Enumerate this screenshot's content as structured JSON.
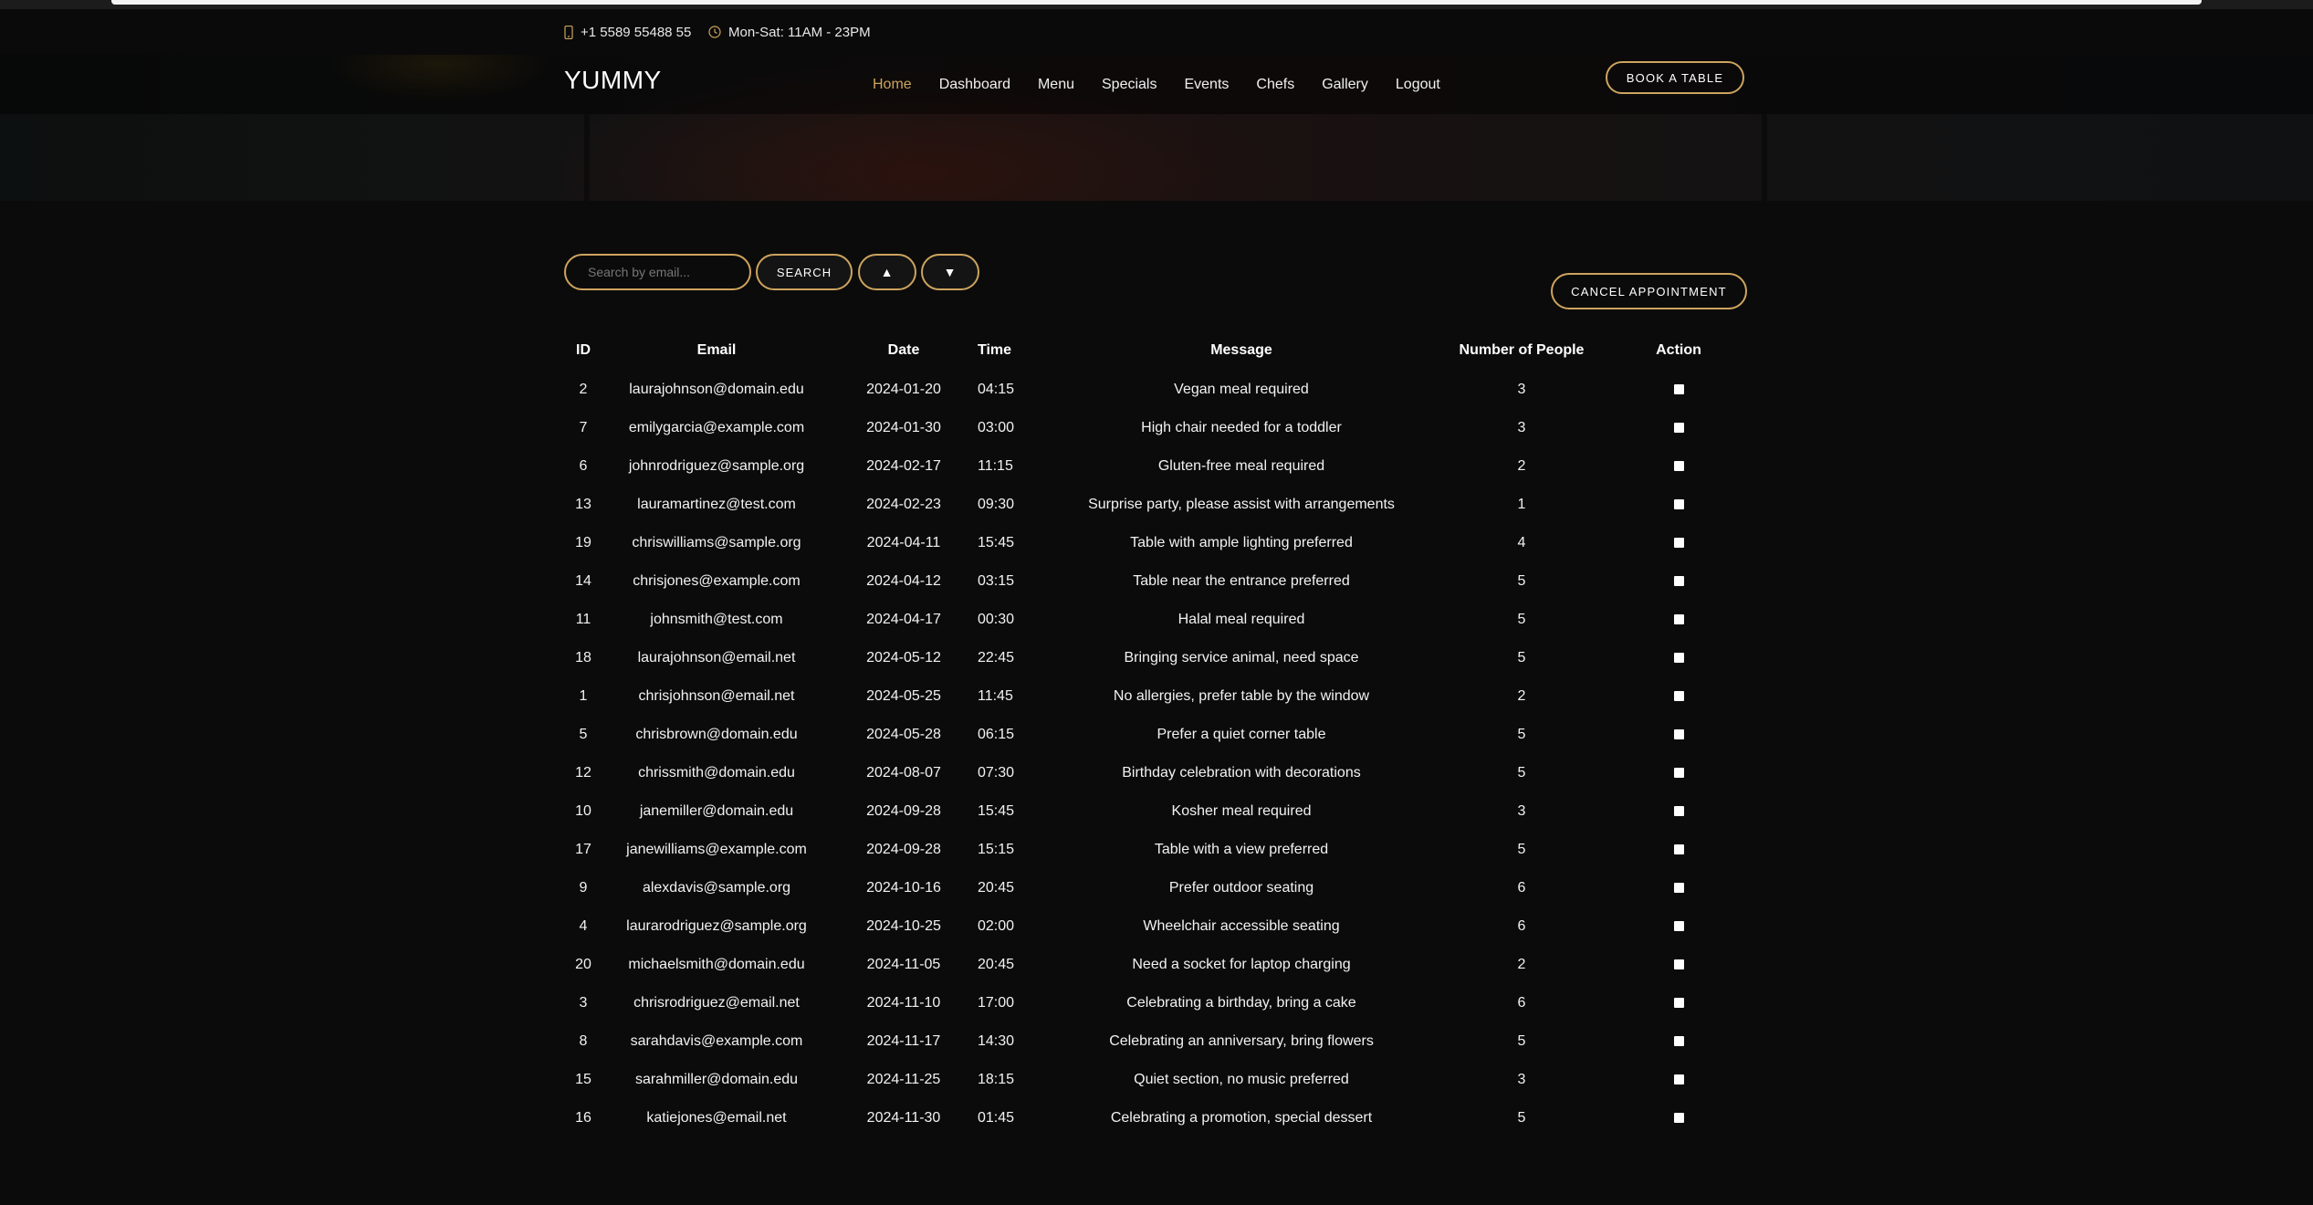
{
  "topbar": {
    "phone": "+1 5589 55488 55",
    "hours": "Mon-Sat: 11AM - 23PM"
  },
  "nav": {
    "logo": "YUMMY",
    "links": [
      "Home",
      "Dashboard",
      "Menu",
      "Specials",
      "Events",
      "Chefs",
      "Gallery",
      "Logout"
    ],
    "active": "Home",
    "cta": "BOOK A TABLE"
  },
  "controls": {
    "search_placeholder": "Search by email...",
    "search_label": "SEARCH",
    "sort_asc": "▲",
    "sort_desc": "▼",
    "cancel_label": "CANCEL APPOINTMENT"
  },
  "table": {
    "headers": [
      "ID",
      "Email",
      "Date",
      "Time",
      "Message",
      "Number of People",
      "Action"
    ],
    "rows": [
      {
        "id": "2",
        "email": "laurajohnson@domain.edu",
        "date": "2024-01-20",
        "time": "04:15",
        "message": "Vegan meal required",
        "people": "3"
      },
      {
        "id": "7",
        "email": "emilygarcia@example.com",
        "date": "2024-01-30",
        "time": "03:00",
        "message": "High chair needed for a toddler",
        "people": "3"
      },
      {
        "id": "6",
        "email": "johnrodriguez@sample.org",
        "date": "2024-02-17",
        "time": "11:15",
        "message": "Gluten-free meal required",
        "people": "2"
      },
      {
        "id": "13",
        "email": "lauramartinez@test.com",
        "date": "2024-02-23",
        "time": "09:30",
        "message": "Surprise party, please assist with arrangements",
        "people": "1"
      },
      {
        "id": "19",
        "email": "chriswilliams@sample.org",
        "date": "2024-04-11",
        "time": "15:45",
        "message": "Table with ample lighting preferred",
        "people": "4"
      },
      {
        "id": "14",
        "email": "chrisjones@example.com",
        "date": "2024-04-12",
        "time": "03:15",
        "message": "Table near the entrance preferred",
        "people": "5"
      },
      {
        "id": "11",
        "email": "johnsmith@test.com",
        "date": "2024-04-17",
        "time": "00:30",
        "message": "Halal meal required",
        "people": "5"
      },
      {
        "id": "18",
        "email": "laurajohnson@email.net",
        "date": "2024-05-12",
        "time": "22:45",
        "message": "Bringing service animal, need space",
        "people": "5"
      },
      {
        "id": "1",
        "email": "chrisjohnson@email.net",
        "date": "2024-05-25",
        "time": "11:45",
        "message": "No allergies, prefer table by the window",
        "people": "2"
      },
      {
        "id": "5",
        "email": "chrisbrown@domain.edu",
        "date": "2024-05-28",
        "time": "06:15",
        "message": "Prefer a quiet corner table",
        "people": "5"
      },
      {
        "id": "12",
        "email": "chrissmith@domain.edu",
        "date": "2024-08-07",
        "time": "07:30",
        "message": "Birthday celebration with decorations",
        "people": "5"
      },
      {
        "id": "10",
        "email": "janemiller@domain.edu",
        "date": "2024-09-28",
        "time": "15:45",
        "message": "Kosher meal required",
        "people": "3"
      },
      {
        "id": "17",
        "email": "janewilliams@example.com",
        "date": "2024-09-28",
        "time": "15:15",
        "message": "Table with a view preferred",
        "people": "5"
      },
      {
        "id": "9",
        "email": "alexdavis@sample.org",
        "date": "2024-10-16",
        "time": "20:45",
        "message": "Prefer outdoor seating",
        "people": "6"
      },
      {
        "id": "4",
        "email": "laurarodriguez@sample.org",
        "date": "2024-10-25",
        "time": "02:00",
        "message": "Wheelchair accessible seating",
        "people": "6"
      },
      {
        "id": "20",
        "email": "michaelsmith@domain.edu",
        "date": "2024-11-05",
        "time": "20:45",
        "message": "Need a socket for laptop charging",
        "people": "2"
      },
      {
        "id": "3",
        "email": "chrisrodriguez@email.net",
        "date": "2024-11-10",
        "time": "17:00",
        "message": "Celebrating a birthday, bring a cake",
        "people": "6"
      },
      {
        "id": "8",
        "email": "sarahdavis@example.com",
        "date": "2024-11-17",
        "time": "14:30",
        "message": "Celebrating an anniversary, bring flowers",
        "people": "5"
      },
      {
        "id": "15",
        "email": "sarahmiller@domain.edu",
        "date": "2024-11-25",
        "time": "18:15",
        "message": "Quiet section, no music preferred",
        "people": "3"
      },
      {
        "id": "16",
        "email": "katiejones@email.net",
        "date": "2024-11-30",
        "time": "01:45",
        "message": "Celebrating a promotion, special dessert",
        "people": "5"
      }
    ]
  },
  "icons": {
    "phone": "phone-icon",
    "clock": "clock-icon"
  },
  "colors": {
    "accent": "#cda45e",
    "background": "#0c0b0b"
  }
}
